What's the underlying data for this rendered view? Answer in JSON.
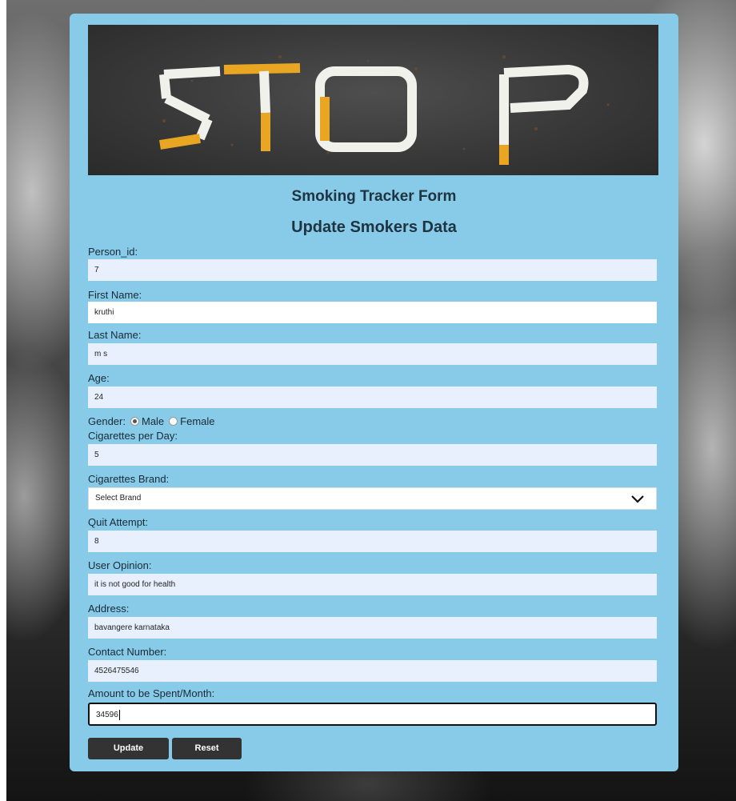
{
  "form": {
    "title": "Smoking Tracker Form",
    "subtitle": "Update Smokers Data",
    "hero_text": "STOP",
    "fields": {
      "person_id": {
        "label": "Person_id:",
        "value": "7"
      },
      "first_name": {
        "label": "First Name:",
        "value": "kruthi"
      },
      "last_name": {
        "label": "Last Name:",
        "value": "m s"
      },
      "age": {
        "label": "Age:",
        "value": "24"
      },
      "gender": {
        "label": "Gender:",
        "options": [
          "Male",
          "Female"
        ],
        "selected": "Male"
      },
      "cigarettes_per_day": {
        "label": "Cigarettes per Day:",
        "value": "5"
      },
      "cigarettes_brand": {
        "label": "Cigarettes Brand:",
        "selected": "Select Brand"
      },
      "quit_attempt": {
        "label": "Quit Attempt:",
        "value": "8"
      },
      "user_opinion": {
        "label": "User Opinion:",
        "value": "it is not good for health"
      },
      "address": {
        "label": "Address:",
        "value": "bavangere karnataka"
      },
      "contact_number": {
        "label": "Contact Number:",
        "value": "4526475546"
      },
      "amount_per_month": {
        "label": "Amount to be Spent/Month:",
        "value": "34596"
      }
    },
    "buttons": {
      "update": "Update",
      "reset": "Reset"
    }
  },
  "colors": {
    "card_background": "#87cbe8",
    "input_autofill": "#e8f0fe",
    "button": "#333333"
  },
  "icons": {
    "dropdown": "chevron-down-icon"
  }
}
